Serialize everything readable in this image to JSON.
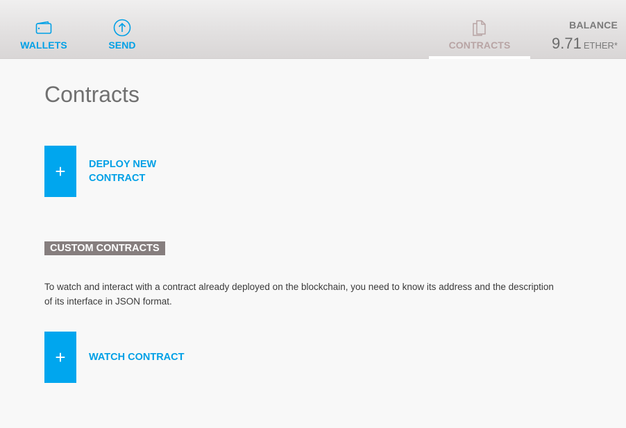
{
  "nav": {
    "wallets": {
      "label": "WALLETS",
      "icon": "wallet-icon"
    },
    "send": {
      "label": "SEND",
      "icon": "arrow-up-circle-icon"
    },
    "contracts": {
      "label": "CONTRACTS",
      "icon": "document-icon",
      "active": true
    }
  },
  "balance": {
    "label": "BALANCE",
    "value": "9.71",
    "unit": "ETHER*"
  },
  "page": {
    "title": "Contracts",
    "deploy_label": "DEPLOY NEW CONTRACT",
    "custom_heading": "CUSTOM CONTRACTS",
    "description": "To watch and interact with a contract already deployed on the blockchain, you need to know its address and the description of its interface in JSON format.",
    "watch_label": "WATCH CONTRACT",
    "plus_symbol": "+"
  },
  "colors": {
    "accent": "#00a6ee",
    "heading_bg": "#867e7e",
    "inactive_nav": "#b8a4a4"
  }
}
